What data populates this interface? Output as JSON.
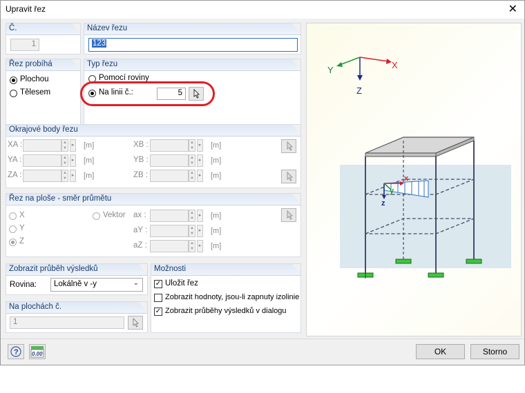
{
  "window": {
    "title": "Upravit řez",
    "close_glyph": "✕"
  },
  "no_group": {
    "label": "Č.",
    "value": "1"
  },
  "name_group": {
    "label": "Název řezu",
    "value": "123"
  },
  "direction_group": {
    "label": "Řez probíhá",
    "options": [
      "Plochou",
      "Tělesem"
    ],
    "selected": "Plochou"
  },
  "type_group": {
    "label": "Typ řezu",
    "options": [
      "Pomocí roviny",
      "Na linii č.:"
    ],
    "selected": "Na linii č.:",
    "line_no": "5"
  },
  "boundary_group": {
    "label": "Okrajové body řezu",
    "left": [
      {
        "label": "XA :",
        "unit": "[m]"
      },
      {
        "label": "YA :",
        "unit": "[m]"
      },
      {
        "label": "ZA :",
        "unit": "[m]"
      }
    ],
    "right": [
      {
        "label": "XB :",
        "unit": "[m]"
      },
      {
        "label": "YB :",
        "unit": "[m]"
      },
      {
        "label": "ZB :",
        "unit": "[m]"
      }
    ]
  },
  "projection_group": {
    "label": "Řez na ploše - směr průmětu",
    "options": [
      "X",
      "Y",
      "Z"
    ],
    "selected": "Z",
    "vector_label": "Vektor",
    "fields": [
      {
        "label": "ax :",
        "unit": "[m]"
      },
      {
        "label": "aY :",
        "unit": "[m]"
      },
      {
        "label": "aZ :",
        "unit": "[m]"
      }
    ]
  },
  "results_group": {
    "label": "Zobrazit průběh výsledků",
    "plane_label": "Rovina:",
    "plane_value": "Lokálně v -y"
  },
  "surfaces_group": {
    "label": "Na plochách č.",
    "value": "1"
  },
  "options_group": {
    "label": "Možnosti",
    "items": [
      {
        "label": "Uložit řez",
        "checked": true
      },
      {
        "label": "Zobrazit hodnoty, jsou-li zapnuty izolinie",
        "checked": false
      },
      {
        "label": "Zobrazit průběhy výsledků v dialogu",
        "checked": true
      }
    ]
  },
  "preview": {
    "axis_y": "Y",
    "axis_x": "X",
    "axis_z": "Z",
    "local_x": "x",
    "local_y": "y",
    "local_z": "z"
  },
  "footer": {
    "ok": "OK",
    "cancel": "Storno",
    "units_icon_text": "0.00"
  }
}
